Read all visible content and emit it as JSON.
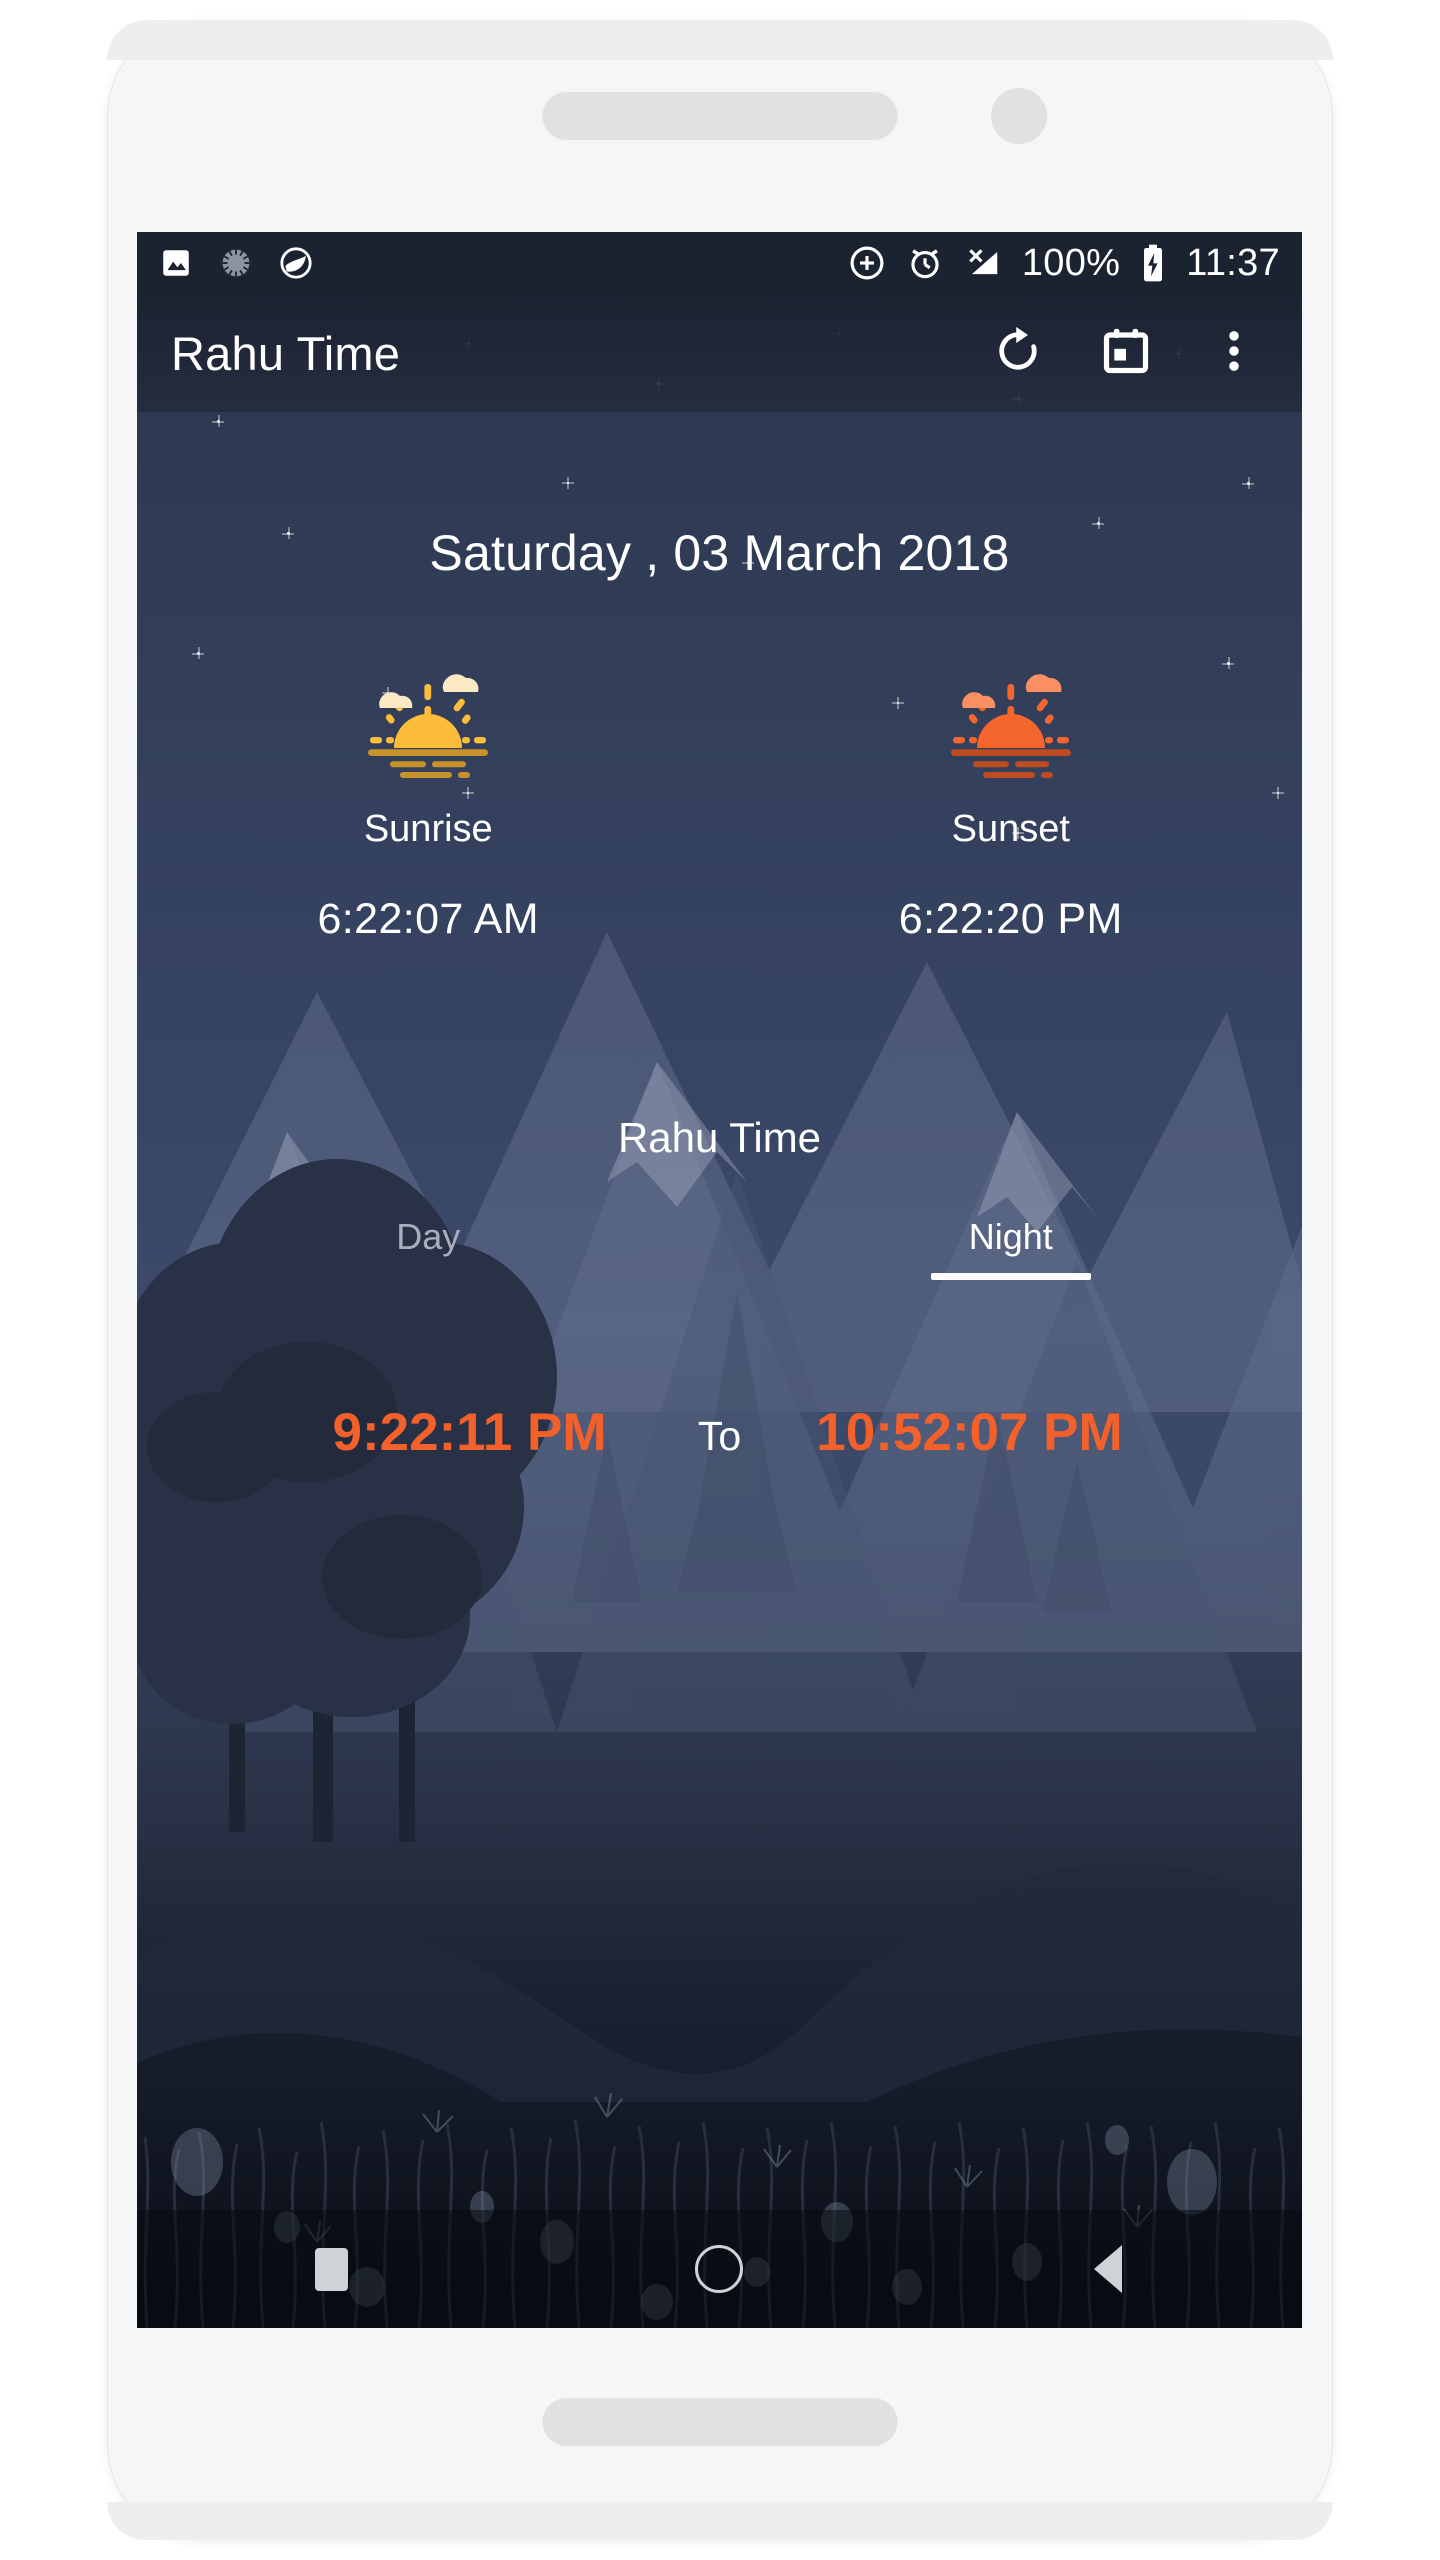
{
  "device": {
    "earpiece": "speaker-grille",
    "camera": "front-camera"
  },
  "status_bar": {
    "left_icons": [
      "photo-icon",
      "spinner-icon",
      "leaf-circle-icon"
    ],
    "right_icons": [
      "add-circle-icon",
      "alarm-icon",
      "no-signal-icon",
      "battery-charging-icon"
    ],
    "battery_percent": "100%",
    "clock": "11:37"
  },
  "app_bar": {
    "title": "Rahu Time",
    "actions": [
      {
        "name": "refresh-icon",
        "label": "Refresh"
      },
      {
        "name": "calendar-icon",
        "label": "Calendar"
      },
      {
        "name": "overflow-menu-icon",
        "label": "More options"
      }
    ]
  },
  "main": {
    "date": "Saturday , 03 March 2018",
    "sun": [
      {
        "icon": "sunrise-icon",
        "label": "Sunrise",
        "time": "6:22:07 AM"
      },
      {
        "icon": "sunset-icon",
        "label": "Sunset",
        "time": "6:22:20 PM"
      }
    ],
    "section_title": "Rahu Time",
    "tabs": [
      {
        "label": "Day",
        "active": false
      },
      {
        "label": "Night",
        "active": true
      }
    ],
    "range": {
      "start": "9:22:11 PM",
      "separator": "To",
      "end": "10:52:07 PM"
    }
  },
  "nav_bar": {
    "buttons": [
      {
        "name": "recents-button",
        "label": "Recents"
      },
      {
        "name": "home-button",
        "label": "Home"
      },
      {
        "name": "back-button",
        "label": "Back"
      }
    ]
  },
  "colors": {
    "accent_orange": "#f4602a",
    "sky_top": "#232a3c",
    "sky_mid": "#3d4a6b",
    "ground": "#0d1119",
    "status_bar_bg": "#1b2230",
    "text_primary": "#ffffff",
    "text_muted": "#a8aebd"
  }
}
